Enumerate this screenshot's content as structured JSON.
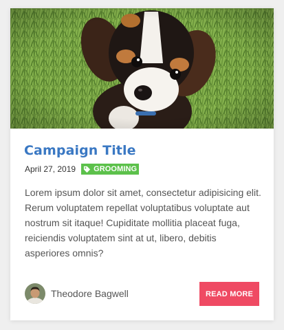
{
  "card": {
    "image": "puppy-on-grass-photo",
    "title": "Campaign Title",
    "date": "April 27, 2019",
    "tag": {
      "icon": "tag-icon",
      "label": "GROOMING",
      "color": "#5cc14b"
    },
    "body": "Lorem ipsum dolor sit amet, consectetur adipisicing elit. Rerum voluptatem repellat voluptatibus voluptate aut nostrum sit itaque! Cupiditate mollitia placeat fuga, reiciendis voluptatem sint at ut, libero, debitis asperiores omnis?",
    "author": {
      "name": "Theodore Bagwell",
      "avatar": "author-avatar-photo"
    },
    "read_more_label": "READ MORE"
  },
  "colors": {
    "title": "#3a78c3",
    "button": "#ef4a63",
    "tag": "#5cc14b",
    "background": "#efefef"
  }
}
